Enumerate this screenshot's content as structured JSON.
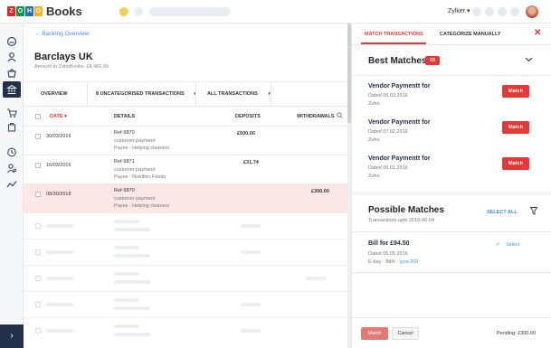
{
  "app": {
    "logo_letters": [
      "Z",
      "O",
      "H",
      "O"
    ],
    "logo_colors": [
      "#e42527",
      "#089949",
      "#226db4",
      "#f9b21d"
    ],
    "product_name": "Books",
    "org_name": "Zylker ▾"
  },
  "sidebar": {
    "icons": [
      "dashboard-icon",
      "contacts-icon",
      "items-icon",
      "banking-icon",
      "sales-icon",
      "purchases-icon",
      "time-tracking-icon",
      "accountant-icon",
      "reports-icon"
    ],
    "expand_glyph": "›"
  },
  "main": {
    "back_link": "← Banking Overview",
    "account_name": "Barclays UK",
    "account_amount": "Amount In ZohoBooks: £8,482.59",
    "tabs": {
      "overview": "OVERVIEW",
      "uncategorised": "8 UNCATEGORISED TRANSACTIONS",
      "all": "ALL TRANSACTIONS",
      "caret": "▾"
    },
    "table": {
      "headers": {
        "date": "DATE ▾",
        "details": "DETAILS",
        "deposits": "DEPOSITS",
        "withdrawals": "WITHDRAWALS"
      },
      "rows": [
        {
          "date": "30/03/2016",
          "ref": "Ref-9870",
          "desc": "customer payment",
          "payee": "Payee : Helping cleaners",
          "deposit": "£500.00",
          "withdrawal": ""
        },
        {
          "date": "16/03/2016",
          "ref": "Ref-9871",
          "desc": "customer payment",
          "payee": "Payee : Nutrifivo Foods",
          "deposit": "£31.74",
          "withdrawal": ""
        },
        {
          "date": "08/30/2018",
          "ref": "Ref-9870",
          "desc": "customer payment",
          "payee": "Payee : Helping cleaners",
          "deposit": "",
          "withdrawal": "£300.00"
        }
      ]
    }
  },
  "panel": {
    "tabs": {
      "match": "MATCH TRANSACTIONS",
      "categorize": "CATEGORIZE MANUALLY"
    },
    "close": "✕",
    "best_matches": {
      "title": "Best Matches",
      "count": "03",
      "items": [
        {
          "title": "Vendor Paymentt for",
          "date": "Dated 06.03.2016",
          "sub": "Zoho",
          "button": "Match"
        },
        {
          "title": "Vendor Paymentt for",
          "date": "Dated 07.02.2016",
          "sub": "Zoho",
          "button": "Match"
        },
        {
          "title": "Vendor Paymentt for",
          "date": "Dated 06.01.2016",
          "sub": "Zoho",
          "button": "Match"
        }
      ]
    },
    "possible_matches": {
      "title": "Possible Matches",
      "subtitle": "Transactions upto 2016-06-04",
      "select_all": "SELECT ALL",
      "item": {
        "title": "Bill for £94.50",
        "date": "Dated 05.05.2016",
        "sub_prefix": "E-bay · Bill# ·",
        "sub_link": "lyca-202",
        "check": "✓",
        "select": "Select"
      }
    },
    "footer": {
      "match": "Match",
      "cancel": "Cancel",
      "pending": "Pending: £300.00"
    }
  },
  "colors": {
    "accent": "#e53935",
    "link": "#408dfb",
    "sidebar_active": "#23304a",
    "selected_row": "#fbe7e6"
  }
}
